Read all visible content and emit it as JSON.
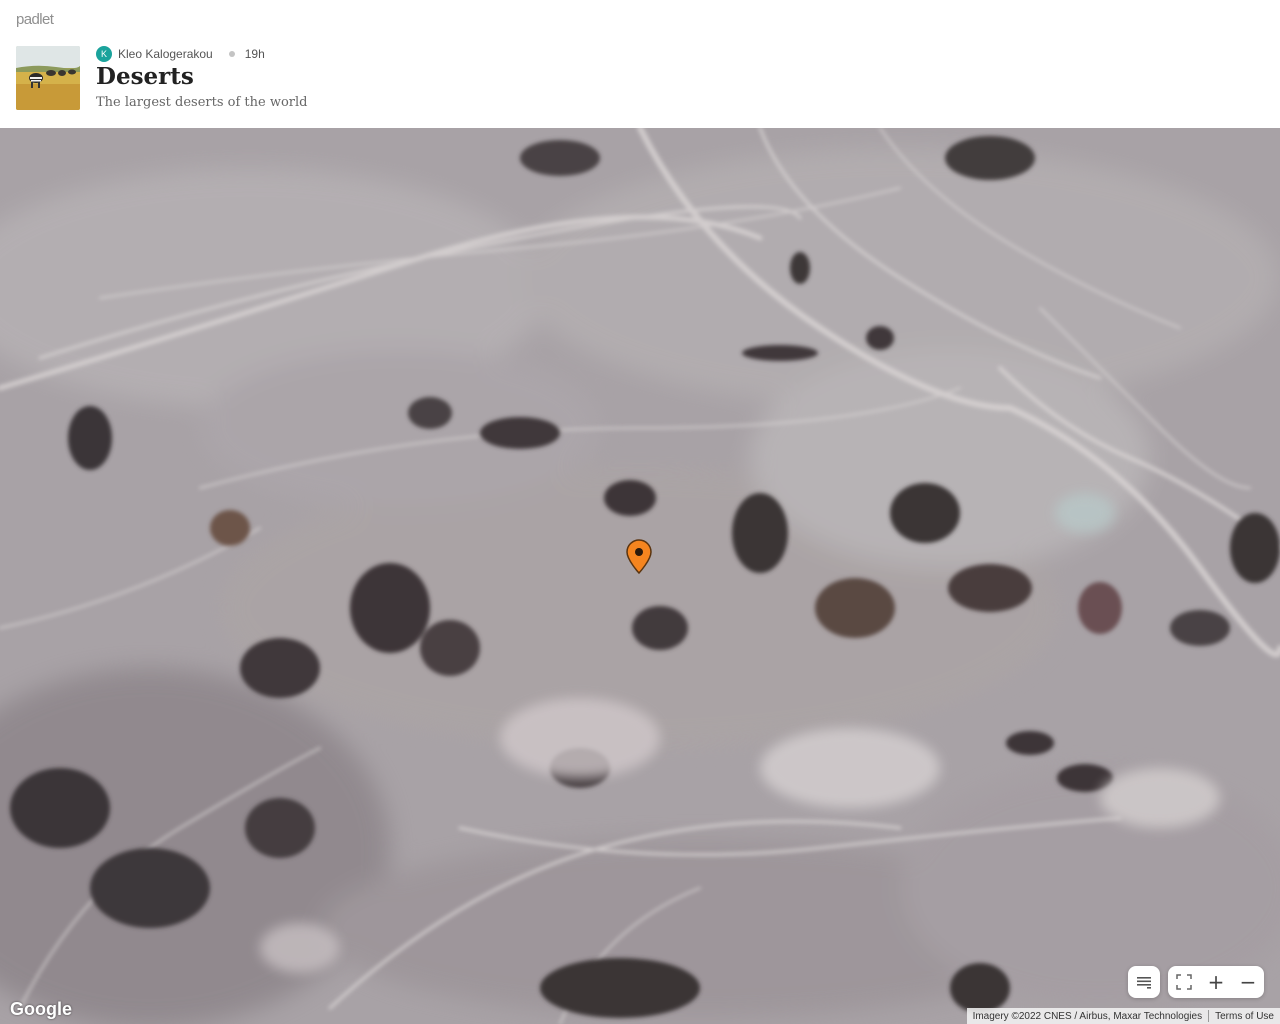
{
  "app": {
    "brand": "padlet"
  },
  "board": {
    "author_initial": "K",
    "author_name": "Kleo Kalogerakou",
    "time_ago": "19h",
    "title": "Deserts",
    "subtitle": "The largest deserts of the world"
  },
  "map": {
    "provider_logo": "Google",
    "attribution": "Imagery ©2022 CNES / Airbus, Maxar Technologies",
    "terms_label": "Terms of Use",
    "marker_color": "#f5851f",
    "marker_icon": "map-pin-icon",
    "controls": {
      "legend_icon": "list-icon",
      "fullscreen_icon": "fullscreen-icon",
      "zoom_in_label": "+",
      "zoom_out_label": "−"
    }
  },
  "colors": {
    "avatar": "#1ba39c",
    "accent": "#f5851f"
  }
}
